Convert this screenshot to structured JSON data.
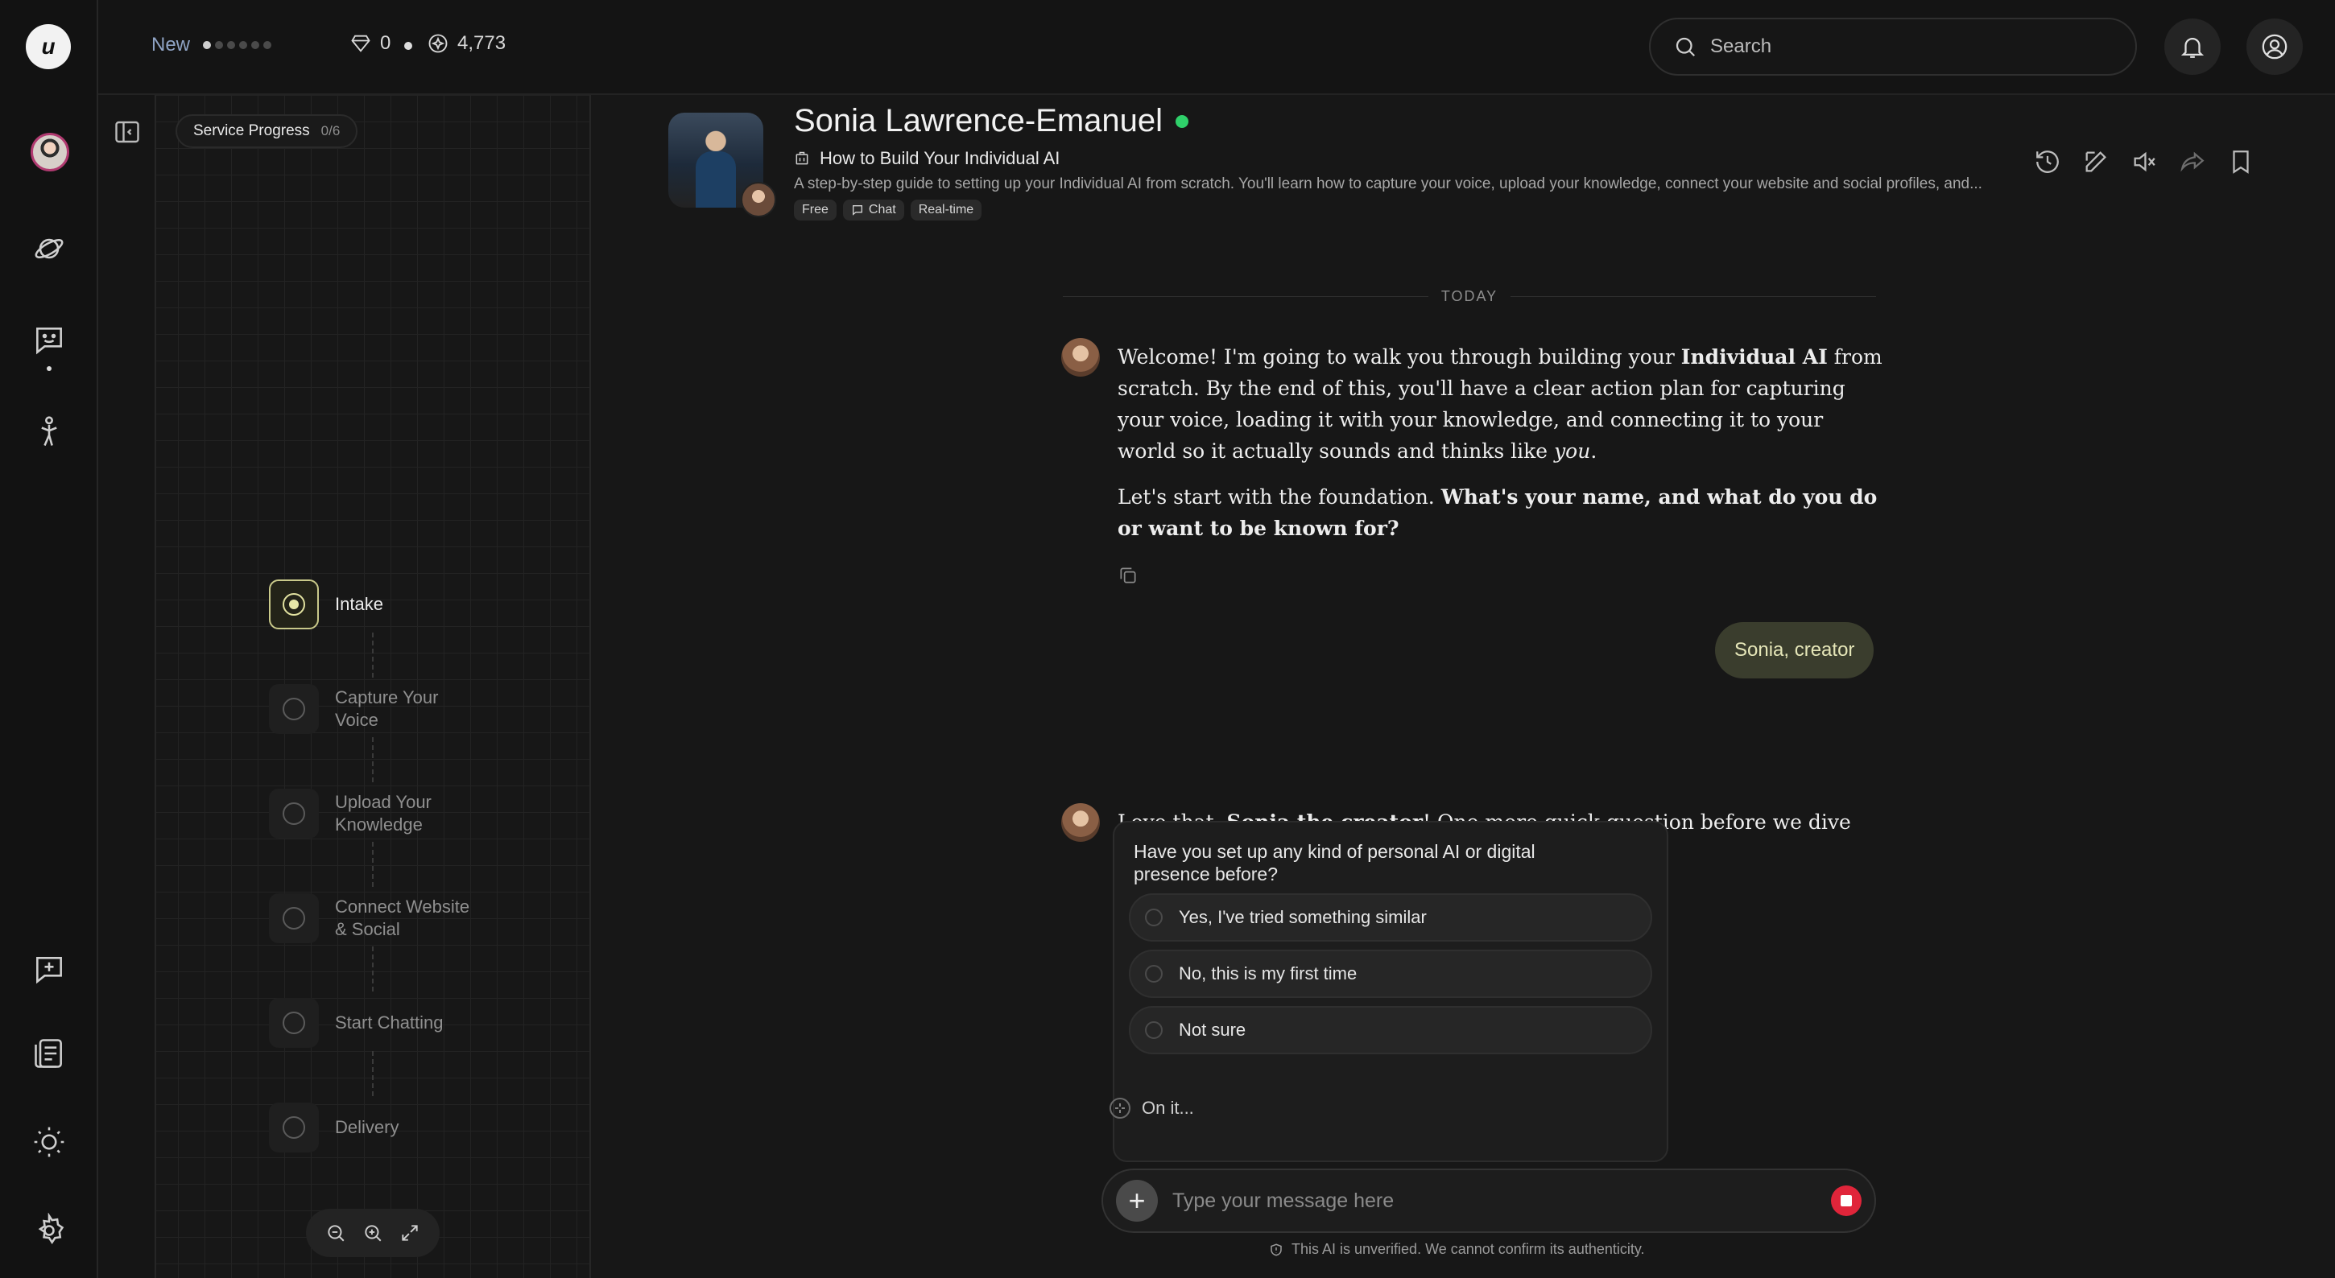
{
  "topbar": {
    "new_label": "New",
    "steps_total": 6,
    "steps_done": 1,
    "stat_a": "0",
    "stat_b": "4,773",
    "search_placeholder": "Search"
  },
  "rail": {
    "icons": [
      "logo-icon",
      "profile-avatar",
      "explore-icon",
      "chat-icon",
      "agent-icon",
      "new-chat-icon",
      "library-icon",
      "theme-icon",
      "settings-icon"
    ]
  },
  "panel": {
    "title": "Service Progress",
    "count": "0/6",
    "steps": [
      {
        "label": "Intake",
        "active": true
      },
      {
        "label": "Capture Your Voice",
        "active": false
      },
      {
        "label": "Upload Your Knowledge",
        "active": false
      },
      {
        "label": "Connect Website & Social",
        "active": false
      },
      {
        "label": "Start Chatting",
        "active": false
      },
      {
        "label": "Delivery",
        "active": false
      }
    ]
  },
  "header": {
    "agent_name": "Sonia Lawrence-Emanuel",
    "guide_title": "How to Build Your Individual AI",
    "guide_desc": "A step-by-step guide to setting up your Individual AI from scratch. You'll learn how to capture your voice, upload your knowledge, connect your website and social profiles, and...",
    "tags": [
      "Free",
      "Chat",
      "Real-time"
    ]
  },
  "chat": {
    "date_divider": "TODAY",
    "msg1_p1_a": "Welcome! I'm going to walk you through building your ",
    "msg1_p1_b": "Individual AI",
    "msg1_p1_c": " from scratch. By the end of this, you'll have a clear action plan for capturing your voice, loading it with your knowledge, and connecting it to your world so it actually sounds and thinks like ",
    "msg1_p1_d": "you",
    "msg1_p1_e": ".",
    "msg1_p2_a": "Let's start with the foundation. ",
    "msg1_p2_b": "What's your name, and what do you do or want to be known for?",
    "user_msg": "Sonia, creator",
    "msg2_a": "Love that, ",
    "msg2_b": "Sonia the creator",
    "msg2_c": "! One more quick question before we dive in.",
    "question": "Have you set up any kind of personal AI or digital presence before?",
    "options": [
      "Yes, I've tried something similar",
      "No, this is my first time",
      "Not sure"
    ],
    "status": "On it...",
    "composer_placeholder": "Type your message here",
    "disclaimer": "This AI is unverified. We cannot confirm its authenticity."
  },
  "colors": {
    "accent_online": "#2fd06a",
    "accent_stop": "#e0253a",
    "user_bubble": "#3a3d2d"
  }
}
